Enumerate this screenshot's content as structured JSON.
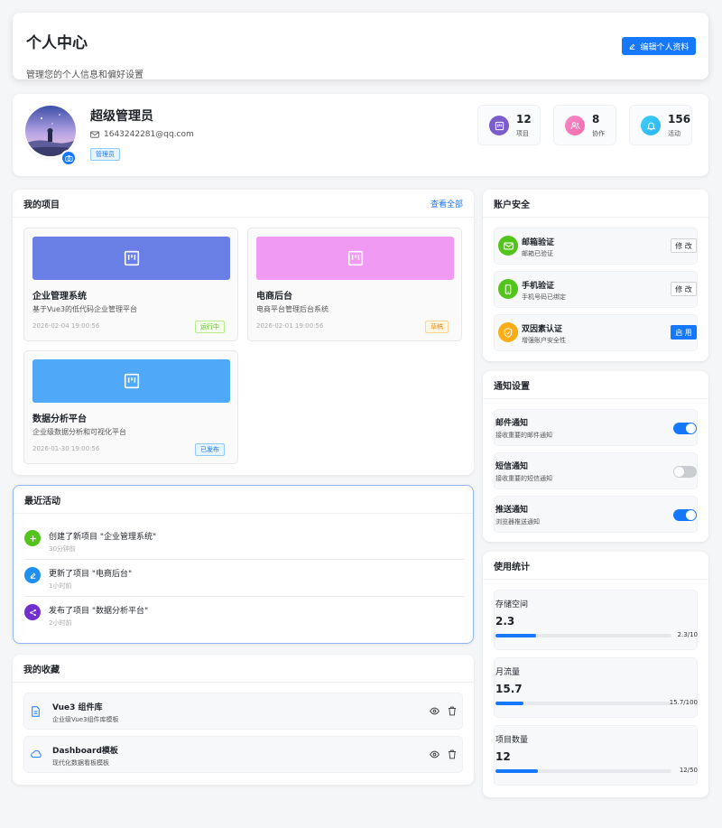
{
  "header": {
    "title": "个人中心",
    "subtitle": "管理您的个人信息和偏好设置",
    "edit_label": "编辑个人资料"
  },
  "profile": {
    "name": "超级管理员",
    "email": "1643242281@qq.com",
    "role": "管理员",
    "stats": [
      {
        "value": "12",
        "label": "项目",
        "icon": "projects-icon",
        "color": "#7b5ccc"
      },
      {
        "value": "8",
        "label": "协作",
        "icon": "collab-icon",
        "color": "#f36aa8"
      },
      {
        "value": "156",
        "label": "活动",
        "icon": "bell-icon",
        "color": "#2fb2f5"
      }
    ]
  },
  "projects": {
    "title": "我的项目",
    "view_all": "查看全部",
    "items": [
      {
        "name": "企业管理系统",
        "desc": "基于Vue3的低代码企业管理平台",
        "date": "2026-02-04 19:00:56",
        "status": "运行中",
        "banner": "#6a7fe6",
        "status_color": "#52c41a"
      },
      {
        "name": "电商后台",
        "desc": "电商平台管理后台系统",
        "date": "2026-02-01 19:00:56",
        "status": "草稿",
        "banner": "#f09af4",
        "status_color": "#fa8c16"
      },
      {
        "name": "数据分析平台",
        "desc": "企业级数据分析和可视化平台",
        "date": "2026-01-30 19:00:56",
        "status": "已发布",
        "banner": "#4fa9f8",
        "status_color": "#1677ff"
      }
    ]
  },
  "activity": {
    "title": "最近活动",
    "items": [
      {
        "text": "创建了新项目 \"企业管理系统\"",
        "time": "30分钟前",
        "color": "#52c41a",
        "icon": "plus-icon"
      },
      {
        "text": "更新了项目 \"电商后台\"",
        "time": "1小时前",
        "color": "#1f8ff0",
        "icon": "edit-icon"
      },
      {
        "text": "发布了项目 \"数据分析平台\"",
        "time": "2小时前",
        "color": "#722ed1",
        "icon": "share-icon"
      }
    ]
  },
  "favorites": {
    "title": "我的收藏",
    "items": [
      {
        "name": "Vue3 组件库",
        "desc": "企业级Vue3组件库模板",
        "icon": "document-icon"
      },
      {
        "name": "Dashboard模板",
        "desc": "现代化数据看板模板",
        "icon": "cloud-icon"
      }
    ]
  },
  "security": {
    "title": "账户安全",
    "items": [
      {
        "name": "邮箱验证",
        "desc": "邮箱已验证",
        "action": "修 改",
        "color": "#52c41a",
        "icon": "mail-icon"
      },
      {
        "name": "手机验证",
        "desc": "手机号码已绑定",
        "action": "修 改",
        "color": "#52c41a",
        "icon": "phone-icon"
      },
      {
        "name": "双因素认证",
        "desc": "增强账户安全性",
        "action": "启 用",
        "color": "#faad14",
        "icon": "shield-icon"
      }
    ]
  },
  "notifications": {
    "title": "通知设置",
    "items": [
      {
        "name": "邮件通知",
        "desc": "接收重要的邮件通知",
        "enabled": true
      },
      {
        "name": "短信通知",
        "desc": "接收重要的短信通知",
        "enabled": false
      },
      {
        "name": "推送通知",
        "desc": "浏览器推送通知",
        "enabled": true
      }
    ]
  },
  "usage": {
    "title": "使用统计",
    "items": [
      {
        "label": "存储空间",
        "value": "2.3",
        "meter": "2.3/10",
        "fraction": 0.23
      },
      {
        "label": "月流量",
        "value": "15.7",
        "meter": "15.7/100",
        "fraction": 0.157
      },
      {
        "label": "项目数量",
        "value": "12",
        "meter": "12/50",
        "fraction": 0.24
      }
    ]
  }
}
